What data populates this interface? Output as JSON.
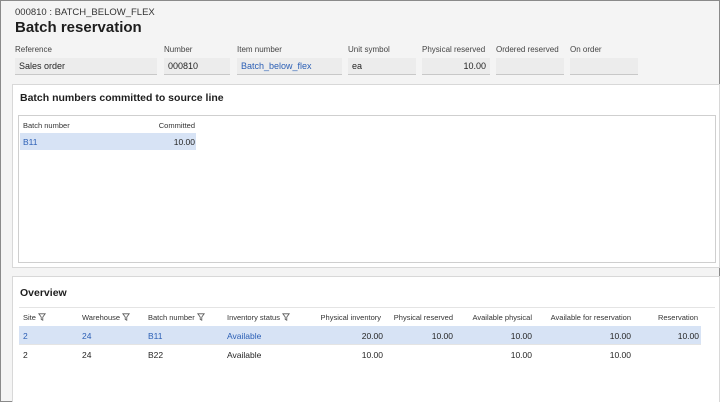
{
  "breadcrumb": "000810 : BATCH_BELOW_FLEX",
  "title": "Batch reservation",
  "header_fields": {
    "reference": {
      "label": "Reference",
      "value": "Sales order"
    },
    "number": {
      "label": "Number",
      "value": "000810"
    },
    "item_number": {
      "label": "Item number",
      "value": "Batch_below_flex"
    },
    "unit_symbol": {
      "label": "Unit symbol",
      "value": "ea"
    },
    "physical_reserved": {
      "label": "Physical reserved",
      "value": "10.00"
    },
    "ordered_reserved": {
      "label": "Ordered reserved",
      "value": ""
    },
    "on_order": {
      "label": "On order",
      "value": ""
    }
  },
  "committed_section": {
    "title": "Batch numbers committed to source line",
    "columns": {
      "batch_number": "Batch number",
      "committed": "Committed"
    },
    "rows": [
      {
        "batch_number": "B11",
        "committed": "10.00"
      }
    ]
  },
  "overview": {
    "title": "Overview",
    "columns": {
      "site": "Site",
      "warehouse": "Warehouse",
      "batch_number": "Batch number",
      "inventory_status": "Inventory status",
      "physical_inventory": "Physical inventory",
      "physical_reserved": "Physical reserved",
      "available_physical": "Available physical",
      "available_for_reservation": "Available for reservation",
      "reservation": "Reservation"
    },
    "rows": [
      {
        "site": "2",
        "warehouse": "24",
        "batch_number": "B11",
        "inventory_status": "Available",
        "physical_inventory": "20.00",
        "physical_reserved": "10.00",
        "available_physical": "10.00",
        "available_for_reservation": "10.00",
        "reservation": "10.00"
      },
      {
        "site": "2",
        "warehouse": "24",
        "batch_number": "B22",
        "inventory_status": "Available",
        "physical_inventory": "10.00",
        "physical_reserved": "",
        "available_physical": "10.00",
        "available_for_reservation": "10.00",
        "reservation": ""
      }
    ]
  },
  "colors": {
    "link": "#2b5fb5",
    "selected_row": "#d7e3f5",
    "field_bg": "#ececec"
  }
}
